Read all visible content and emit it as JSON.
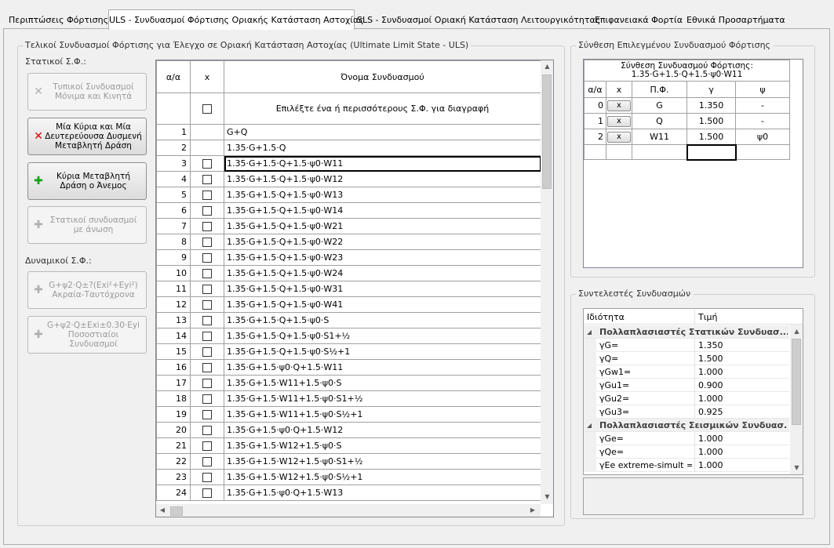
{
  "tabs": [
    {
      "label": "Περιπτώσεις Φόρτισης",
      "active": false
    },
    {
      "label": "ULS - Συνδυασμοί Φόρτισης Οριακής Κατάσταση Αστοχίας",
      "active": true
    },
    {
      "label": "SLS - Συνδυασμοί Οριακή Κατάσταση Λειτουργικότητας",
      "active": false
    },
    {
      "label": "Επιφανειακά Φορτία",
      "active": false
    },
    {
      "label": "Εθνικά Προσαρτήματα",
      "active": false
    }
  ],
  "left_group": {
    "title": "Τελικοί Συνδυασμοί Φόρτισης για Έλεγχο σε Οριακή Κατάσταση Αστοχίας (Ultimate Limit State - ULS)",
    "static_label": "Στατικοί Σ.Φ.:",
    "dynamic_label": "Δυναμικοί Σ.Φ.:",
    "buttons": [
      {
        "label": "Τυπικοί Συνδυασμοί Μόνιμα και Κινητά",
        "icon": "x-icon",
        "enabled": false
      },
      {
        "label": "Μία Κύρια και Μία Δευτερεύουσα Δυσμενή Μεταβλητή Δράση",
        "icon": "red-x-icon",
        "enabled": true
      },
      {
        "label": "Κύρια Μεταβλητή Δράση ο Άνεμος",
        "icon": "plus-icon",
        "enabled": true
      },
      {
        "label": "Στατικοί συνδυασμοί με άνωση",
        "icon": "plus-icon",
        "enabled": false
      },
      {
        "label": "G+ψ2·Q±?(Exi²+Eyi²) Ακραία-Ταυτόχρονα",
        "icon": "plus-icon",
        "enabled": false
      },
      {
        "label": "G+ψ2·Q±Exi±0.30·Eyi Ποσοστιαίοι Συνδυασμοί",
        "icon": "plus-icon",
        "enabled": false
      }
    ]
  },
  "combo_grid": {
    "headers": {
      "index": "α/α",
      "x": "x",
      "name": "Όνομα Συνδυασμού"
    },
    "select_row_text": "Επιλέξτε ένα ή περισσότερους Σ.Φ. για διαγραφή",
    "rows": [
      {
        "n": "1",
        "cb": false,
        "name": "G+Q"
      },
      {
        "n": "2",
        "cb": false,
        "name": "1.35·G+1.5·Q"
      },
      {
        "n": "3",
        "cb": true,
        "name": "1.35·G+1.5·Q+1.5·ψ0·W11",
        "selected": true
      },
      {
        "n": "4",
        "cb": true,
        "name": "1.35·G+1.5·Q+1.5·ψ0·W12"
      },
      {
        "n": "5",
        "cb": true,
        "name": "1.35·G+1.5·Q+1.5·ψ0·W13"
      },
      {
        "n": "6",
        "cb": true,
        "name": "1.35·G+1.5·Q+1.5·ψ0·W14"
      },
      {
        "n": "7",
        "cb": true,
        "name": "1.35·G+1.5·Q+1.5·ψ0·W21"
      },
      {
        "n": "8",
        "cb": true,
        "name": "1.35·G+1.5·Q+1.5·ψ0·W22"
      },
      {
        "n": "9",
        "cb": true,
        "name": "1.35·G+1.5·Q+1.5·ψ0·W23"
      },
      {
        "n": "10",
        "cb": true,
        "name": "1.35·G+1.5·Q+1.5·ψ0·W24"
      },
      {
        "n": "11",
        "cb": true,
        "name": "1.35·G+1.5·Q+1.5·ψ0·W31"
      },
      {
        "n": "12",
        "cb": true,
        "name": "1.35·G+1.5·Q+1.5·ψ0·W41"
      },
      {
        "n": "13",
        "cb": true,
        "name": "1.35·G+1.5·Q+1.5·ψ0·S"
      },
      {
        "n": "14",
        "cb": true,
        "name": "1.35·G+1.5·Q+1.5·ψ0·S1+½"
      },
      {
        "n": "15",
        "cb": true,
        "name": "1.35·G+1.5·Q+1.5·ψ0·S½+1"
      },
      {
        "n": "16",
        "cb": true,
        "name": "1.35·G+1.5·ψ0·Q+1.5·W11"
      },
      {
        "n": "17",
        "cb": true,
        "name": "1.35·G+1.5·W11+1.5·ψ0·S"
      },
      {
        "n": "18",
        "cb": true,
        "name": "1.35·G+1.5·W11+1.5·ψ0·S1+½"
      },
      {
        "n": "19",
        "cb": true,
        "name": "1.35·G+1.5·W11+1.5·ψ0·S½+1"
      },
      {
        "n": "20",
        "cb": true,
        "name": "1.35·G+1.5·ψ0·Q+1.5·W12"
      },
      {
        "n": "21",
        "cb": true,
        "name": "1.35·G+1.5·W12+1.5·ψ0·S"
      },
      {
        "n": "22",
        "cb": true,
        "name": "1.35·G+1.5·W12+1.5·ψ0·S1+½"
      },
      {
        "n": "23",
        "cb": true,
        "name": "1.35·G+1.5·W12+1.5·ψ0·S½+1"
      },
      {
        "n": "24",
        "cb": true,
        "name": "1.35·G+1.5·ψ0·Q+1.5·W13"
      }
    ]
  },
  "composition_group": {
    "title": "Σύνθεση Επιλεγμένου Συνδυασμού Φόρτισης",
    "header_line1": "Σύνθεση Συνδυασμού Φόρτισης:",
    "header_line2": "1.35·G+1.5·Q+1.5·ψ0·W11",
    "columns": {
      "index": "α/α",
      "x": "x",
      "load_case": "Π.Φ.",
      "gamma": "γ",
      "psi": "ψ"
    },
    "rows": [
      {
        "n": "0",
        "x": "x",
        "lc": "G",
        "gamma": "1.350",
        "psi": "-"
      },
      {
        "n": "1",
        "x": "x",
        "lc": "Q",
        "gamma": "1.500",
        "psi": "-"
      },
      {
        "n": "2",
        "x": "x",
        "lc": "W11",
        "gamma": "1.500",
        "psi": "ψ0"
      }
    ]
  },
  "coefficients_group": {
    "title": "Συντελεστές Συνδυασμών",
    "headers": {
      "property": "Ιδιότητα",
      "value": "Τιμή"
    },
    "rows": [
      {
        "type": "category",
        "label": "Πολλαπλασιαστές Στατικών Συνδυασ...",
        "value": ""
      },
      {
        "type": "item",
        "label": "γG=",
        "value": "1.350"
      },
      {
        "type": "item",
        "label": "γQ=",
        "value": "1.500"
      },
      {
        "type": "item",
        "label": "γGw1=",
        "value": "1.000"
      },
      {
        "type": "item",
        "label": "γGu1=",
        "value": "0.900"
      },
      {
        "type": "item",
        "label": "γGu2=",
        "value": "1.000"
      },
      {
        "type": "item",
        "label": "γGu3=",
        "value": "0.925"
      },
      {
        "type": "category",
        "label": "Πολλαπλασιαστές Σεισμικών Συνδυασ...",
        "value": ""
      },
      {
        "type": "item",
        "label": "γGe=",
        "value": "1.000"
      },
      {
        "type": "item",
        "label": "γQe=",
        "value": "1.000"
      },
      {
        "type": "item",
        "label": "γEe extreme-simult =",
        "value": "1.000"
      }
    ]
  }
}
